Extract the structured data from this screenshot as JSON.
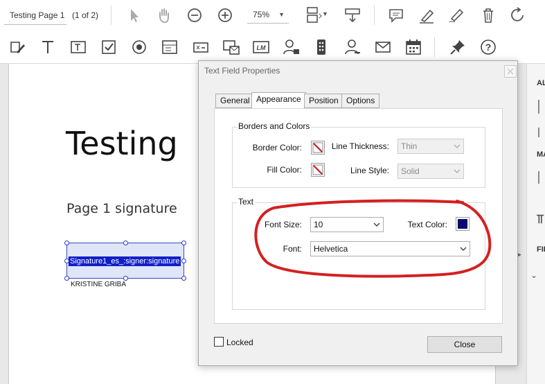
{
  "toolbar": {
    "document_name": "Testing Page 1",
    "page_count": "(1 of 2)",
    "zoom": "75%",
    "icons_row1": [
      "select-arrow-icon",
      "hand-icon",
      "zoom-out-icon",
      "zoom-in-icon",
      "page-fit-icon",
      "scroll-mode-icon",
      "comment-icon",
      "highlight-icon",
      "sign-icon",
      "delete-icon",
      "rotate-icon"
    ],
    "icons_row2": [
      "edit-form-icon",
      "text-tool-icon",
      "text-field-icon",
      "checkbox-icon",
      "radio-button-icon",
      "list-box-icon",
      "dropdown-icon",
      "image-field-icon",
      "barcode-icon",
      "add-recipient-icon",
      "field-list-icon",
      "signer-icon",
      "email-icon",
      "date-icon",
      "pin-icon",
      "help-icon"
    ]
  },
  "document": {
    "title": "Testing",
    "subtitle": "Page 1 signature",
    "signature_field_label": "Signature1_es_:signer:signature",
    "signer_name": "KRISTINE GRIBA"
  },
  "right_panel": {
    "label_1": "AL",
    "label_2": "MA",
    "label_3": "FIE"
  },
  "dialog": {
    "title": "Text Field Properties",
    "tabs": [
      {
        "label": "General",
        "active": false
      },
      {
        "label": "Appearance",
        "active": true
      },
      {
        "label": "Position",
        "active": false
      },
      {
        "label": "Options",
        "active": false
      }
    ],
    "borders_group": {
      "caption": "Borders and Colors",
      "border_color_label": "Border Color:",
      "fill_color_label": "Fill Color:",
      "line_thickness_label": "Line Thickness:",
      "line_thickness_value": "Thin",
      "line_style_label": "Line Style:",
      "line_style_value": "Solid"
    },
    "text_group": {
      "caption": "Text",
      "font_size_label": "Font Size:",
      "font_size_value": "10",
      "text_color_label": "Text Color:",
      "text_color": "#0a0a6e",
      "font_label": "Font:",
      "font_value": "Helvetica"
    },
    "locked_label": "Locked",
    "close_label": "Close"
  },
  "colors": {
    "annotation_circle": "#d42020",
    "signature_highlight": "#1020c8"
  }
}
